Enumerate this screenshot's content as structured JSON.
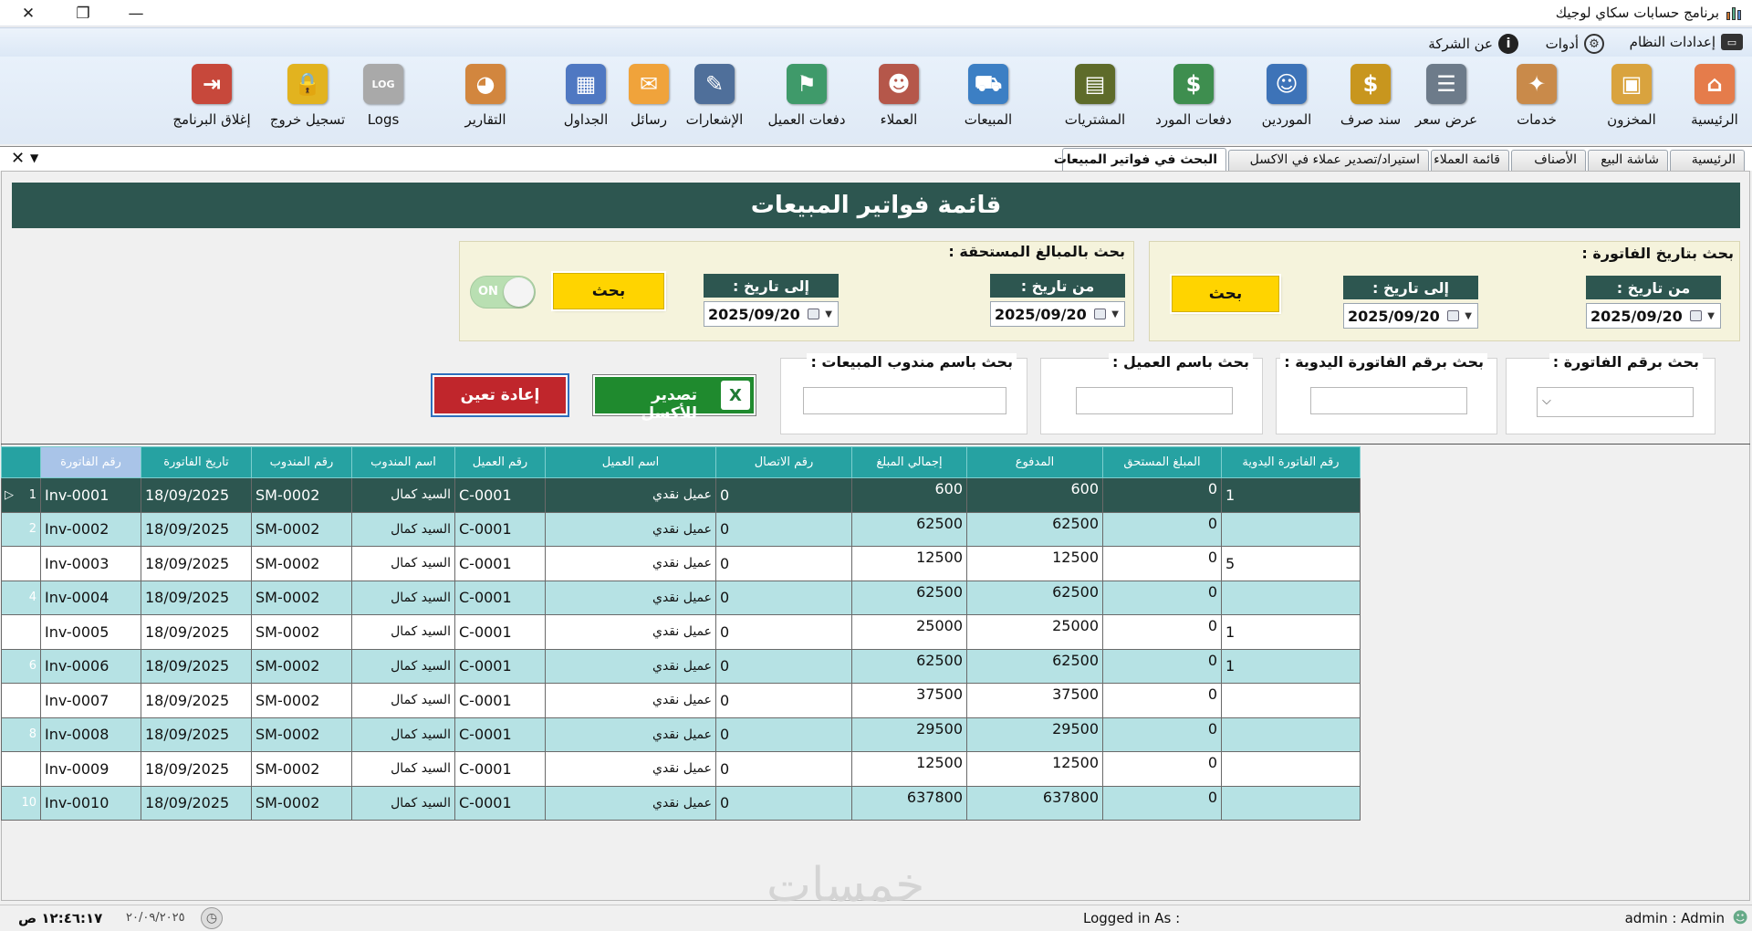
{
  "window": {
    "title": "برنامج حسابات سكاي لوجيك",
    "close": "✕",
    "restore": "❐",
    "minimize": "—"
  },
  "menu": {
    "system_settings": "إعدادات النظام",
    "tools": "أدوات",
    "about": "عن الشركة"
  },
  "toolbar": [
    {
      "key": "home",
      "label": "الرئيسية",
      "icon": "house-icon",
      "glyph": "⌂",
      "color": "#e57c4b"
    },
    {
      "key": "inventory",
      "label": "المخزون",
      "icon": "boxes-icon",
      "glyph": "▣",
      "color": "#d9a33e"
    },
    {
      "key": "services",
      "label": "خدمات",
      "icon": "service-box-icon",
      "glyph": "✦",
      "color": "#c98a4a"
    },
    {
      "key": "quote",
      "label": "عرض سعر",
      "icon": "quote-sheet-icon",
      "glyph": "☰",
      "color": "#6d7b8a"
    },
    {
      "key": "voucher",
      "label": "سند صرف",
      "icon": "voucher-icon",
      "glyph": "$",
      "color": "#c8961e"
    },
    {
      "key": "suppliers",
      "label": "الموردين",
      "icon": "supplier-person-icon",
      "glyph": "☺",
      "color": "#3d73b8"
    },
    {
      "key": "supplier_payments",
      "label": "دفعات المورد",
      "icon": "cash-bill-icon",
      "glyph": "$",
      "color": "#3e8e4f"
    },
    {
      "key": "purchases",
      "label": "المشتريات",
      "icon": "purchase-register-icon",
      "glyph": "▤",
      "color": "#5e6b2a"
    },
    {
      "key": "sales",
      "label": "المبيعات",
      "icon": "shopping-cart-icon",
      "glyph": "⛟",
      "color": "#3c7fc4"
    },
    {
      "key": "customers",
      "label": "العملاء",
      "icon": "customers-group-icon",
      "glyph": "☻",
      "color": "#b5574a"
    },
    {
      "key": "customer_payments",
      "label": "دفعات العميل",
      "icon": "handshake-money-icon",
      "glyph": "⚑",
      "color": "#3f9a6a"
    },
    {
      "key": "notices",
      "label": "الإشعارات",
      "icon": "notice-pen-icon",
      "glyph": "✎",
      "color": "#4f6f9a"
    },
    {
      "key": "messages",
      "label": "رسائل",
      "icon": "sms-envelope-icon",
      "glyph": "✉",
      "color": "#f0a33b"
    },
    {
      "key": "tables",
      "label": "الجداول",
      "icon": "spreadsheet-icon",
      "glyph": "▦",
      "color": "#4f78c2"
    },
    {
      "key": "reports",
      "label": "التقارير",
      "icon": "pie-report-icon",
      "glyph": "◕",
      "color": "#d2863e"
    },
    {
      "key": "logs",
      "label": "Logs",
      "icon": "log-file-icon",
      "glyph": "LOG",
      "color": "#a9a9a9"
    },
    {
      "key": "logout",
      "label": "تسجيل خروج",
      "icon": "padlock-icon",
      "glyph": "🔒",
      "color": "#e2b31f"
    },
    {
      "key": "exit",
      "label": "إغلاق البرنامج",
      "icon": "exit-door-icon",
      "glyph": "⇥",
      "color": "#c7483b"
    }
  ],
  "tabs": [
    {
      "label": "الرئيسية",
      "active": false
    },
    {
      "label": "شاشة البيع",
      "active": false
    },
    {
      "label": "الأصناف",
      "active": false
    },
    {
      "label": "قائمة العملاء",
      "active": false
    },
    {
      "label": "استيراد/تصدير عملاء في الاكسل",
      "active": false
    },
    {
      "label": "البحث في فواتير المبيعات",
      "active": true
    }
  ],
  "tab_controls": {
    "close": "✕",
    "menu": "▼"
  },
  "page": {
    "title": "قائمة فواتير المبيعات",
    "date_search": {
      "title": "بحث بتاريخ الفاتورة :",
      "from_label": "من تاريخ :",
      "to_label": "إلى تاريخ :",
      "from_value": "2025/09/20",
      "to_value": "2025/09/20",
      "search_label": "بحث"
    },
    "due_search": {
      "title": "بحث بالمبالغ المستحقة :",
      "from_label": "من تاريخ :",
      "to_label": "إلى تاريخ :",
      "from_value": "2025/09/20",
      "to_value": "2025/09/20",
      "search_label": "بحث",
      "toggle_label": "ON"
    },
    "by_invoice_no": "بحث برقم الفاتورة :",
    "by_manual_no": "بحث برقم الفاتورة اليدوية :",
    "by_customer": "بحث باسم العميل :",
    "by_rep": "بحث باسم مندوب المبيعات :",
    "export_label": "تصدير للأكسل",
    "reset_label": "إعادة تعين"
  },
  "grid": {
    "columns": [
      "رقم الفاتورة",
      "تاريخ الفاتورة",
      "رقم المندوب",
      "اسم المندوب",
      "رقم العميل",
      "اسم العميل",
      "رقم الاتصال",
      "إجمالي المبلغ",
      "المدفوع",
      "المبلغ المستحق",
      "رقم الفاتورة اليدوية"
    ],
    "selected_marker": "▷",
    "rows": [
      {
        "n": "1",
        "inv": "Inv-0001",
        "date": "18/09/2025",
        "rep_no": "SM-0002",
        "rep": "السيد كمال",
        "cust_no": "C-0001",
        "cust": "عميل نقدي",
        "phone": "0",
        "total": "600",
        "paid": "600",
        "due": "0",
        "manual": "1"
      },
      {
        "n": "2",
        "inv": "Inv-0002",
        "date": "18/09/2025",
        "rep_no": "SM-0002",
        "rep": "السيد كمال",
        "cust_no": "C-0001",
        "cust": "عميل نقدي",
        "phone": "0",
        "total": "62500",
        "paid": "62500",
        "due": "0",
        "manual": ""
      },
      {
        "n": "3",
        "inv": "Inv-0003",
        "date": "18/09/2025",
        "rep_no": "SM-0002",
        "rep": "السيد كمال",
        "cust_no": "C-0001",
        "cust": "عميل نقدي",
        "phone": "0",
        "total": "12500",
        "paid": "12500",
        "due": "0",
        "manual": "5"
      },
      {
        "n": "4",
        "inv": "Inv-0004",
        "date": "18/09/2025",
        "rep_no": "SM-0002",
        "rep": "السيد كمال",
        "cust_no": "C-0001",
        "cust": "عميل نقدي",
        "phone": "0",
        "total": "62500",
        "paid": "62500",
        "due": "0",
        "manual": ""
      },
      {
        "n": "5",
        "inv": "Inv-0005",
        "date": "18/09/2025",
        "rep_no": "SM-0002",
        "rep": "السيد كمال",
        "cust_no": "C-0001",
        "cust": "عميل نقدي",
        "phone": "0",
        "total": "25000",
        "paid": "25000",
        "due": "0",
        "manual": "1"
      },
      {
        "n": "6",
        "inv": "Inv-0006",
        "date": "18/09/2025",
        "rep_no": "SM-0002",
        "rep": "السيد كمال",
        "cust_no": "C-0001",
        "cust": "عميل نقدي",
        "phone": "0",
        "total": "62500",
        "paid": "62500",
        "due": "0",
        "manual": "1"
      },
      {
        "n": "7",
        "inv": "Inv-0007",
        "date": "18/09/2025",
        "rep_no": "SM-0002",
        "rep": "السيد كمال",
        "cust_no": "C-0001",
        "cust": "عميل نقدي",
        "phone": "0",
        "total": "37500",
        "paid": "37500",
        "due": "0",
        "manual": ""
      },
      {
        "n": "8",
        "inv": "Inv-0008",
        "date": "18/09/2025",
        "rep_no": "SM-0002",
        "rep": "السيد كمال",
        "cust_no": "C-0001",
        "cust": "عميل نقدي",
        "phone": "0",
        "total": "29500",
        "paid": "29500",
        "due": "0",
        "manual": ""
      },
      {
        "n": "9",
        "inv": "Inv-0009",
        "date": "18/09/2025",
        "rep_no": "SM-0002",
        "rep": "السيد كمال",
        "cust_no": "C-0001",
        "cust": "عميل نقدي",
        "phone": "0",
        "total": "12500",
        "paid": "12500",
        "due": "0",
        "manual": ""
      },
      {
        "n": "10",
        "inv": "Inv-0010",
        "date": "18/09/2025",
        "rep_no": "SM-0002",
        "rep": "السيد كمال",
        "cust_no": "C-0001",
        "cust": "عميل نقدي",
        "phone": "0",
        "total": "637800",
        "paid": "637800",
        "due": "0",
        "manual": ""
      }
    ]
  },
  "status": {
    "user": "admin  :  Admin",
    "logged_in": "Logged in As :",
    "date": "٢٠/٠٩/٢٠٢٥",
    "time": "١٢:٤٦:١٧ ص"
  },
  "watermark": "خمسات",
  "colors": {
    "header": "#2d5650",
    "grid_header": "#26a2a2",
    "row_alt": "#b6e2e4",
    "search_button": "#ffd400",
    "export": "#1f8a2e",
    "reset": "#c0262c"
  }
}
